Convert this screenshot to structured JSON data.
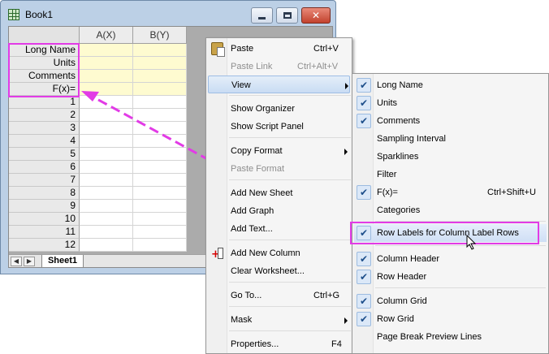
{
  "book": {
    "title": "Book1",
    "columns": [
      "A(X)",
      "B(Y)"
    ],
    "label_rows": [
      "Long Name",
      "Units",
      "Comments",
      "F(x)="
    ],
    "data_rows": [
      "1",
      "2",
      "3",
      "4",
      "5",
      "6",
      "7",
      "8",
      "9",
      "10",
      "11",
      "12"
    ],
    "sheet_tab": "Sheet1",
    "tab_nav": [
      "◀",
      "▶"
    ]
  },
  "context_menu": {
    "items": [
      {
        "label": "Paste",
        "shortcut": "Ctrl+V",
        "icon": "paste-icon"
      },
      {
        "label": "Paste Link",
        "shortcut": "Ctrl+Alt+V",
        "disabled": true
      },
      {
        "label": "View",
        "submenu": true,
        "highlighted": true
      },
      {
        "label": "Show Organizer"
      },
      {
        "label": "Show Script Panel"
      },
      {
        "label": "Copy Format",
        "submenu": true
      },
      {
        "label": "Paste Format",
        "disabled": true
      },
      {
        "label": "Add New Sheet"
      },
      {
        "label": "Add Graph"
      },
      {
        "label": "Add Text..."
      },
      {
        "label": "Add New Column",
        "icon": "add-column-icon"
      },
      {
        "label": "Clear Worksheet..."
      },
      {
        "label": "Go To...",
        "shortcut": "Ctrl+G"
      },
      {
        "label": "Mask",
        "submenu": true
      },
      {
        "label": "Properties...",
        "shortcut": "F4"
      }
    ]
  },
  "view_submenu": {
    "items": [
      {
        "label": "Long Name",
        "checked": true
      },
      {
        "label": "Units",
        "checked": true
      },
      {
        "label": "Comments",
        "checked": true
      },
      {
        "label": "Sampling Interval",
        "checked": false
      },
      {
        "label": "Sparklines",
        "checked": false
      },
      {
        "label": "Filter",
        "checked": false
      },
      {
        "label": "F(x)=",
        "checked": true,
        "shortcut": "Ctrl+Shift+U"
      },
      {
        "label": "Categories",
        "checked": false
      },
      {
        "label": "Row Labels for Column Label Rows",
        "checked": true,
        "focused": true
      },
      {
        "label": "Column Header",
        "checked": true
      },
      {
        "label": "Row Header",
        "checked": true
      },
      {
        "label": "Column Grid",
        "checked": true
      },
      {
        "label": "Row Grid",
        "checked": true
      },
      {
        "label": "Page Break Preview Lines",
        "checked": false
      }
    ]
  },
  "icons": {
    "check": "✔",
    "close": "✕"
  },
  "colors": {
    "annotation": "#e23be6",
    "label_row_fill": "#fefbd0",
    "menu_highlight": "#c9dcf3"
  }
}
